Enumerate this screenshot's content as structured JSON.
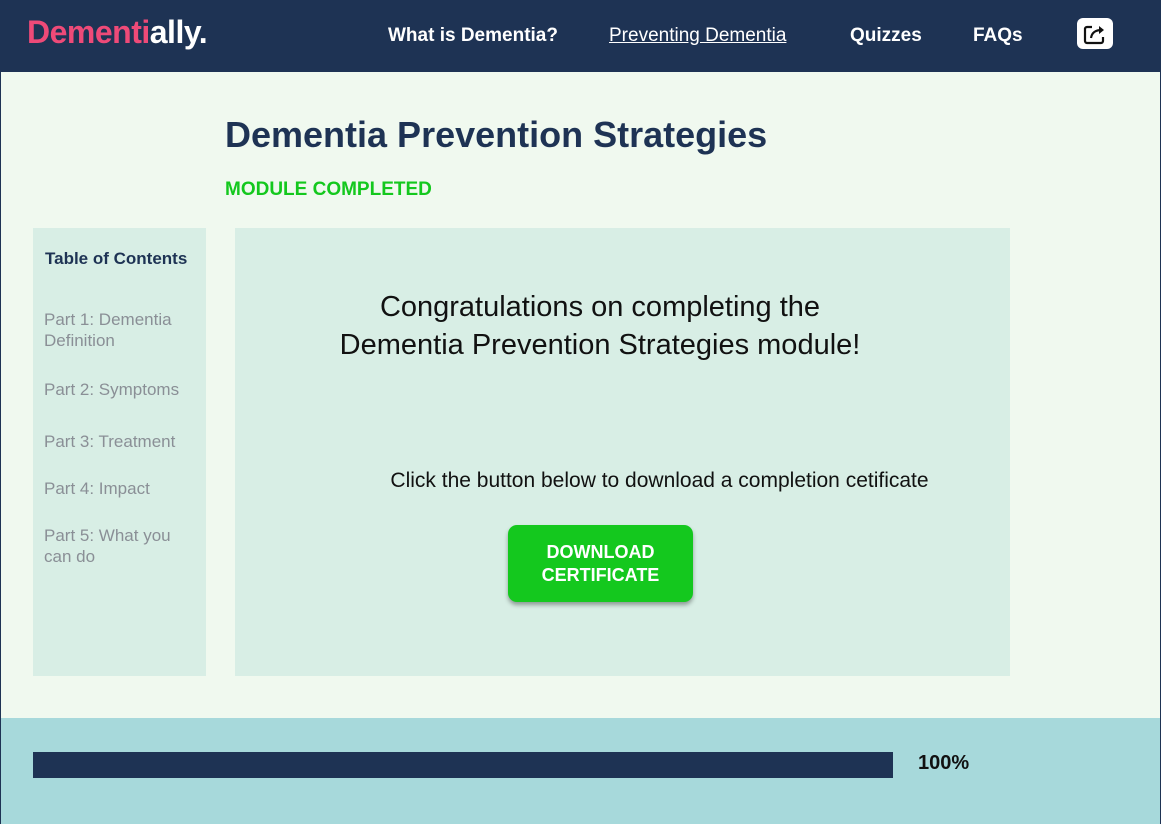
{
  "brand": {
    "logo_accent": "Dementi",
    "logo_rest": "ally."
  },
  "nav": {
    "items": [
      {
        "label": "What is Dementia?"
      },
      {
        "label": "Preventing Dementia"
      },
      {
        "label": "Quizzes"
      },
      {
        "label": "FAQs"
      }
    ],
    "active_item": "Preventing Dementia",
    "share_icon": "share-icon"
  },
  "header": {
    "title": "Dementia Prevention Strategies",
    "status": "MODULE COMPLETED"
  },
  "toc": {
    "heading": "Table of Contents",
    "items": [
      {
        "label": "Part 1: Dementia Definition"
      },
      {
        "label": "Part 2: Symptoms"
      },
      {
        "label": "Part 3: Treatment"
      },
      {
        "label": "Part 4: Impact"
      },
      {
        "label": "Part 5: What you can do"
      }
    ]
  },
  "main": {
    "congrats": "Congratulations on completing the Dementia Prevention Strategies module!",
    "instruction": "Click the button below to download a completion cetificate",
    "download_label": "DOWNLOAD CERTIFICATE"
  },
  "progress": {
    "value": 1.0,
    "label": "100%"
  },
  "colors": {
    "navy": "#1e3354",
    "brand_pink": "#ee4a78",
    "success_green": "#14c81e",
    "panel_bg": "#d8eee5",
    "page_bg": "#f0f9ef",
    "footer_bg": "#a7d9db"
  }
}
